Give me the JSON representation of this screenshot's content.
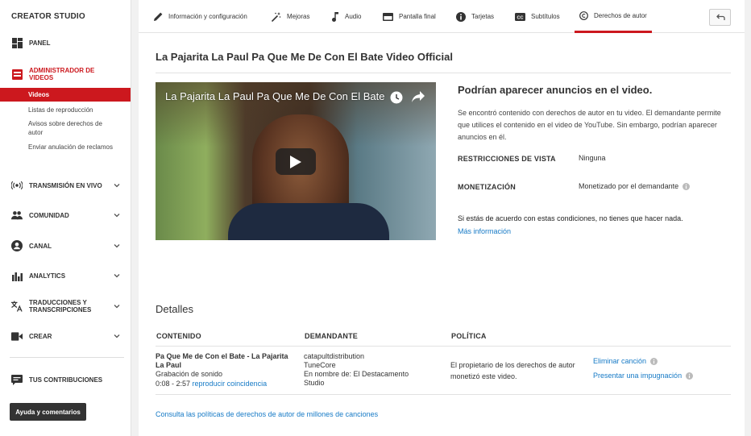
{
  "sidebar": {
    "brand": "CREATOR STUDIO",
    "items": [
      {
        "label": "PANEL",
        "icon": "dashboard-icon"
      },
      {
        "label": "ADMINISTRADOR DE VIDEOS",
        "icon": "video-manager-icon"
      },
      {
        "label": "TRANSMISIÓN EN VIVO",
        "icon": "live-icon"
      },
      {
        "label": "COMUNIDAD",
        "icon": "community-icon"
      },
      {
        "label": "CANAL",
        "icon": "channel-icon"
      },
      {
        "label": "ANALYTICS",
        "icon": "analytics-icon"
      },
      {
        "label": "TRADUCCIONES Y TRANSCRIPCIONES",
        "icon": "translate-icon"
      },
      {
        "label": "CREAR",
        "icon": "create-icon"
      },
      {
        "label": "TUS CONTRIBUCIONES",
        "icon": "contributions-icon"
      }
    ],
    "sub_items": [
      "Videos",
      "Listas de reproducción",
      "Avisos sobre derechos de autor",
      "Enviar anulación de reclamos"
    ],
    "help_button": "Ayuda y comentarios"
  },
  "tabs": [
    {
      "label": "Información y configuración",
      "icon": "pencil-icon"
    },
    {
      "label": "Mejoras",
      "icon": "magic-wand-icon"
    },
    {
      "label": "Audio",
      "icon": "music-note-icon"
    },
    {
      "label": "Pantalla final",
      "icon": "end-screen-icon"
    },
    {
      "label": "Tarjetas",
      "icon": "info-icon"
    },
    {
      "label": "Subtítulos",
      "icon": "cc-icon"
    },
    {
      "label": "Derechos de autor",
      "icon": "copyright-icon"
    }
  ],
  "video": {
    "title": "La Pajarita La Paul Pa Que Me De Con El Bate Video Official",
    "player_title": "La Pajarita La Paul Pa Que Me De Con El Bate Video Official"
  },
  "claim": {
    "heading": "Podrían aparecer anuncios en el video.",
    "description": "Se encontró contenido con derechos de autor en tu video. El demandante permite que utilices el contenido en el video de YouTube. Sin embargo, podrían aparecer anuncios en él.",
    "restrictions_label": "RESTRICCIONES DE VISTA",
    "restrictions_value": "Ninguna",
    "monetization_label": "MONETIZACIÓN",
    "monetization_value": "Monetizado por el demandante",
    "agree_text": "Si estás de acuerdo con estas condiciones, no tienes que hacer nada.",
    "more_info": "Más información"
  },
  "details": {
    "heading": "Detalles",
    "columns": [
      "CONTENIDO",
      "DEMANDANTE",
      "POLÍTICA"
    ],
    "row": {
      "content_title": "Pa Que Me de Con el Bate - La Pajarita La Paul",
      "content_type": "Grabación de sonido",
      "content_time": "0:08 - 2:57",
      "content_link": "reproducir coincidencia",
      "claimant_1": "catapultdistribution",
      "claimant_2": "TuneCore",
      "claimant_3": "En nombre de: El Destacamento Studio",
      "policy": "El propietario de los derechos de autor monetizó este video.",
      "action_1": "Eliminar canción",
      "action_2": "Presentar una impugnación"
    },
    "footer_link": "Consulta las políticas de derechos de autor de millones de canciones"
  },
  "colors": {
    "accent": "#cc181e",
    "link": "#167ac6"
  }
}
